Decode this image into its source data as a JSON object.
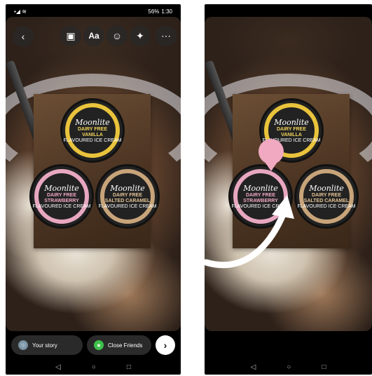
{
  "status_bar": {
    "time": "1:30",
    "battery": "56%"
  },
  "toolbar": {
    "back_icon": "back-arrow-icon",
    "tools": [
      {
        "name": "person-tag-icon",
        "glyph": "👤"
      },
      {
        "label": "Aa"
      },
      {
        "name": "sticker-icon",
        "glyph": "☺"
      },
      {
        "name": "effects-sparkle-icon",
        "glyph": "✦"
      },
      {
        "name": "more-icon",
        "glyph": "⋯"
      }
    ]
  },
  "sticker": {
    "tubs": [
      {
        "brand": "Moonlite",
        "l1": "DAIRY FREE",
        "l2": "VANILLA",
        "l3": "FLAVOURED ICE CREAM"
      },
      {
        "brand": "Moonlite",
        "l1": "DAIRY FREE",
        "l2": "STRAWBERRY",
        "l3": "FLAVOURED ICE CREAM"
      },
      {
        "brand": "Moonlite",
        "l1": "DAIRY FREE",
        "l2": "SALTED CARAMEL",
        "l3": "FLAVOURED ICE CREAM"
      }
    ]
  },
  "bottom": {
    "your_story": "Your story",
    "close_friends": "Close Friends",
    "next_glyph": "›"
  },
  "nav": {
    "back": "◁",
    "home": "○",
    "recents": "□"
  },
  "colors": {
    "gesture_marker": "#f0a9c0",
    "gesture_arrow": "#ffffff"
  }
}
